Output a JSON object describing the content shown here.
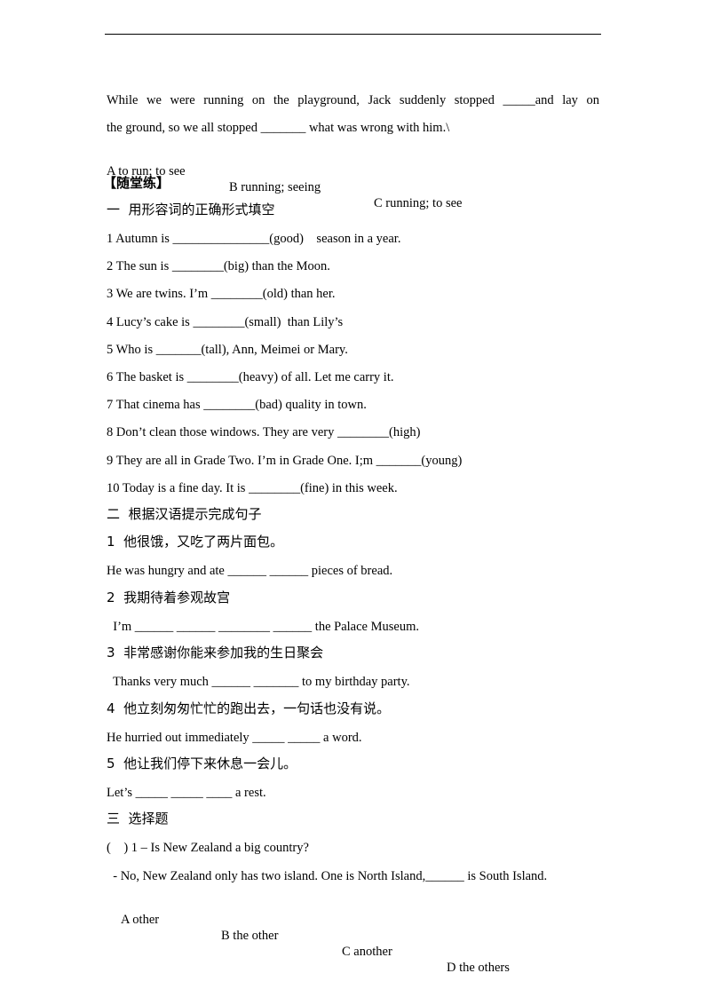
{
  "intro_question": {
    "line1": "While we were running on the playground, Jack suddenly stopped _____and lay on",
    "line2": "the ground, so we all stopped _______ what was wrong with him.\\",
    "options": [
      "A to run; to see",
      "B running; seeing",
      "C running; to see"
    ]
  },
  "practice_heading": "【随堂练】",
  "section1": {
    "title": "一  用形容词的正确形式填空",
    "items": [
      "1 Autumn is _______________(good)    season in a year.",
      "2 The sun is ________(big) than the Moon.",
      "3 We are twins. I’m ________(old) than her.",
      "4 Lucy’s cake is ________(small)  than Lily’s",
      "5 Who is _______(tall), Ann, Meimei or Mary.",
      "6 The basket is ________(heavy) of all. Let me carry it.",
      "7 That cinema has ________(bad) quality in town.",
      "8 Don’t clean those windows. They are very ________(high)",
      "9 They are all in Grade Two. I’m in Grade One. I;m _______(young)",
      "10 Today is a fine day. It is ________(fine) in this week."
    ]
  },
  "section2": {
    "title": "二  根据汉语提示完成句子",
    "items": [
      {
        "prompt": "1  他很饿，又吃了两片面包。",
        "answer": "He was hungry and ate ______ ______ pieces of bread."
      },
      {
        "prompt": "2  我期待着参观故宫",
        "answer": "  I’m ______ ______ ________ ______ the Palace Museum."
      },
      {
        "prompt": "3  非常感谢你能来参加我的生日聚会",
        "answer": "  Thanks very much ______ _______ to my birthday party."
      },
      {
        "prompt": "4  他立刻匆匆忙忙的跑出去，一句话也没有说。",
        "answer": "He hurried out immediately _____ _____ a word."
      },
      {
        "prompt": "5  他让我们停下来休息一会儿。",
        "answer": "Let’s _____ _____ ____ a rest."
      }
    ]
  },
  "section3": {
    "title": "三  选择题",
    "questions": [
      {
        "stem": "(    ) 1 – Is New Zealand a big country?",
        "reply": "  - No, New Zealand only has two island. One is North Island,______ is South Island.",
        "options": [
          "A other",
          "B the other",
          "C another",
          "D the others"
        ]
      }
    ]
  }
}
